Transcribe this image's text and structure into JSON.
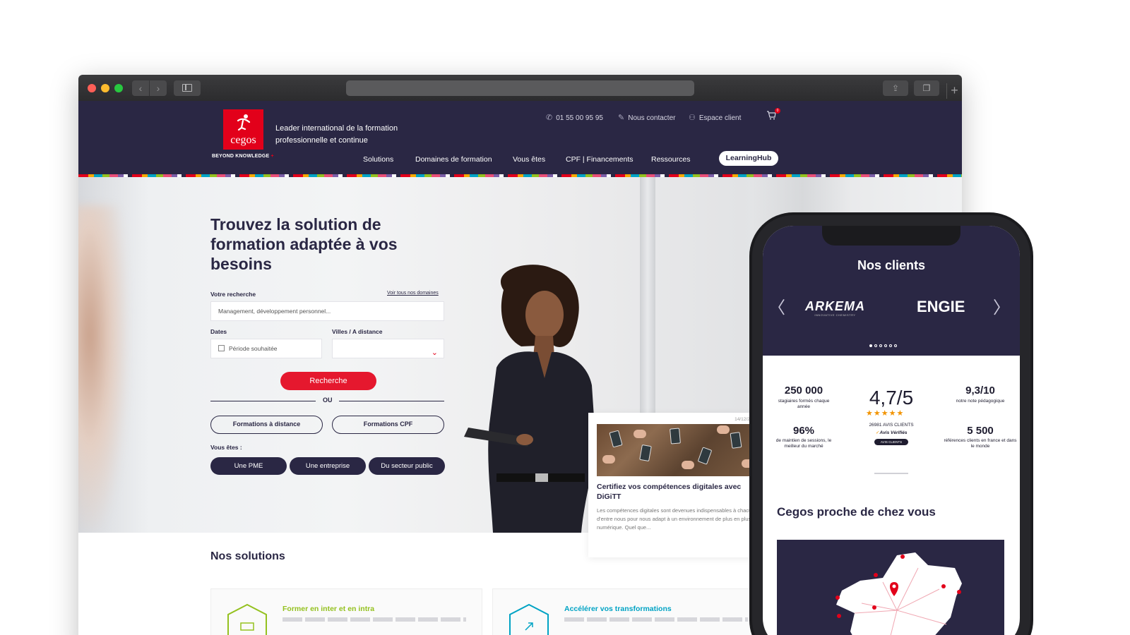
{
  "site": {
    "logo_text": "cegos",
    "logo_tagline": "BEYOND KNOWLEDGE",
    "leader_text": "Leader international de la formation professionnelle et continue",
    "top_links": {
      "phone": "01 55 00 95 95",
      "contact": "Nous contacter",
      "client": "Espace client",
      "cart_count": "0"
    },
    "nav": [
      "Solutions",
      "Domaines de formation",
      "Vous êtes",
      "CPF | Financements",
      "Ressources",
      "LearningHub"
    ]
  },
  "hero": {
    "title": "Trouvez la solution de formation adaptée à vos besoins",
    "search_label": "Votre recherche",
    "all_domains_link": "Voir tous nos domaines",
    "search_placeholder": "Management, développement personnel...",
    "dates_label": "Dates",
    "dates_placeholder": "Période souhaitée",
    "cities_label": "Villes / A distance",
    "search_button": "Recherche",
    "or_text": "OU",
    "remote_button": "Formations à distance",
    "cpf_button": "Formations CPF",
    "you_are_label": "Vous êtes :",
    "audience_buttons": [
      "Une PME",
      "Une entreprise",
      "Du secteur public"
    ]
  },
  "news_card": {
    "date": "14/12/202",
    "title": "Certifiez vos compétences digitales avec DiGiTT",
    "body": "Les compétences digitales sont devenues indispensables à chacun d'entre nous pour nous adapt à un environnement de plus en plus numérique. Quel que..."
  },
  "solutions": {
    "title": "Nos solutions",
    "cards": [
      {
        "title": "Former en inter et en intra",
        "color": "#94c11f"
      },
      {
        "title": "Accélérer vos transformations",
        "color": "#00a3c4"
      }
    ]
  },
  "phone": {
    "clients_title": "Nos clients",
    "client_logos": [
      "ARKEMA",
      "ENGIE"
    ],
    "arkema_sub": "INNOVATIVE CHEMISTRY",
    "carousel_pages": 6,
    "carousel_active": 1,
    "stats": {
      "trainees": "250 000",
      "trainees_label": "stagiaires formés chaque année",
      "rating": "4,7/5",
      "reviews": "26981 AVIS CLIENTS",
      "verified": "Avis Vérifiés",
      "reviews_pill": "AVIS CLIENTS",
      "score": "9,3/10",
      "score_label": "notre note pédagogique",
      "sessions": "96%",
      "sessions_label": "de maintien de sessions, le meilleur du marché",
      "references": "5 500",
      "references_label": "références clients en france et dans le monde"
    },
    "near_title": "Cegos proche de chez vous"
  },
  "colors": {
    "navy": "#2a2744",
    "brand_red": "#e2001a",
    "star_orange": "#f29400"
  }
}
